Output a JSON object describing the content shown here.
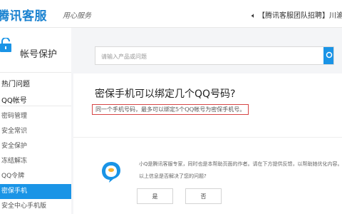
{
  "header": {
    "logo_text": "腾讯客服",
    "slogan": "用心服务",
    "notice_icon": "speaker-icon",
    "notice_text": "【腾讯客服团队招聘】川渝地"
  },
  "sidebar": {
    "icon": "lock-icon",
    "title": "帐号保护",
    "group_hot": "热门问题",
    "group_qq": "QQ帐号",
    "items": [
      {
        "label": "密码管理"
      },
      {
        "label": "安全常识"
      },
      {
        "label": "安全保护"
      },
      {
        "label": "冻结解冻"
      },
      {
        "label": "QQ令牌"
      },
      {
        "label": "密保手机",
        "active": true
      },
      {
        "label": "安全中心手机版"
      }
    ]
  },
  "search": {
    "placeholder": "请输入产品或问题",
    "icon": "search-icon"
  },
  "article": {
    "title": "密保手机可以绑定几个QQ号码?",
    "answer": "同一个手机号码，最多可以绑定5个QQ帐号为密保手机号。"
  },
  "feedback": {
    "avatar_icon": "assistant-avatar-icon",
    "intro": "小Q是腾讯客服专家，同时也是本帮助页面的作者。请在下方提供反馈，以帮助她优化内容。",
    "question": "以上信息是否解决了您的问题?",
    "yes_label": "是",
    "no_label": "否"
  },
  "colors": {
    "brand_blue": "#1a82d0",
    "accent_blue": "#1a94e6",
    "highlight_red": "#d64545"
  }
}
